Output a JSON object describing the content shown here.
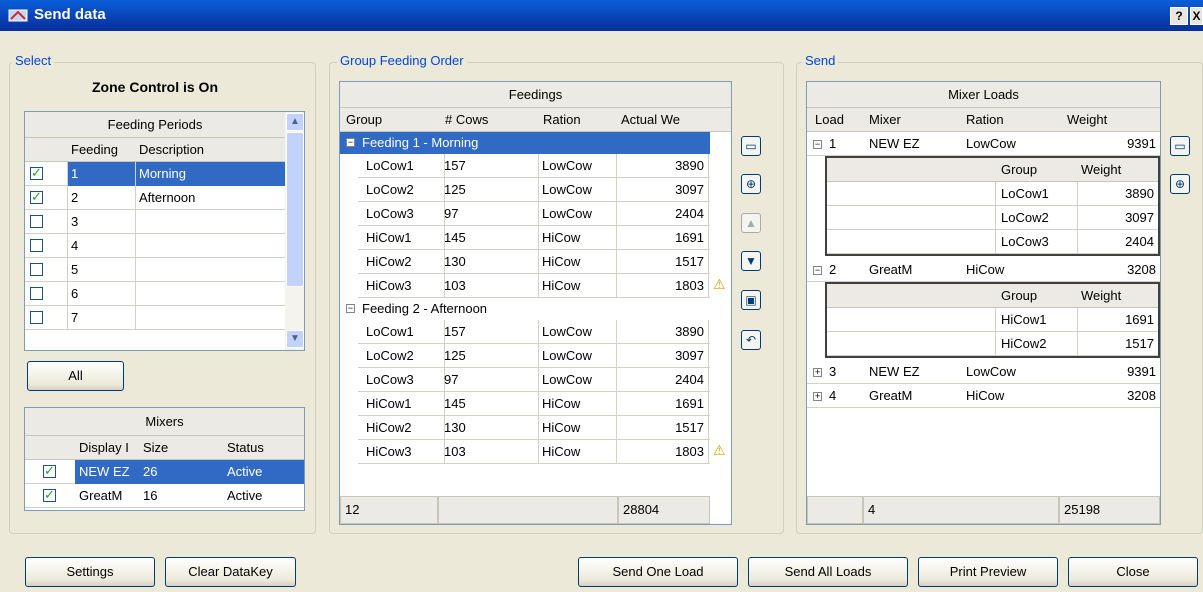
{
  "window": {
    "title": "Send data"
  },
  "select": {
    "legend": "Select",
    "zone_status": "Zone Control is On",
    "feeding_periods": {
      "title": "Feeding Periods",
      "col_feeding": "Feeding",
      "col_description": "Description",
      "rows": [
        {
          "feeding": "1",
          "description": "Morning",
          "checked": true
        },
        {
          "feeding": "2",
          "description": "Afternoon",
          "checked": true
        },
        {
          "feeding": "3",
          "description": "",
          "checked": false
        },
        {
          "feeding": "4",
          "description": "",
          "checked": false
        },
        {
          "feeding": "5",
          "description": "",
          "checked": false
        },
        {
          "feeding": "6",
          "description": "",
          "checked": false
        },
        {
          "feeding": "7",
          "description": "",
          "checked": false
        }
      ]
    },
    "all_label": "All",
    "mixers": {
      "title": "Mixers",
      "col_display": "Display I",
      "col_size": "Size",
      "col_status": "Status",
      "rows": [
        {
          "name": "NEW EZ",
          "size": "26",
          "status": "Active"
        },
        {
          "name": "GreatM",
          "size": "16",
          "status": "Active"
        }
      ]
    }
  },
  "order": {
    "legend": "Group Feeding Order",
    "title": "Feedings",
    "columns": [
      "Group",
      "# Cows",
      "Ration",
      "Actual We"
    ],
    "feedings": [
      {
        "label": "Feeding 1 - Morning",
        "rows": [
          {
            "group": "LoCow1",
            "cows": "157",
            "ration": "LowCow",
            "weight": "3890",
            "warn": false
          },
          {
            "group": "LoCow2",
            "cows": "125",
            "ration": "LowCow",
            "weight": "3097",
            "warn": false
          },
          {
            "group": "LoCow3",
            "cows": "97",
            "ration": "LowCow",
            "weight": "2404",
            "warn": false
          },
          {
            "group": "HiCow1",
            "cows": "145",
            "ration": "HiCow",
            "weight": "1691",
            "warn": false
          },
          {
            "group": "HiCow2",
            "cows": "130",
            "ration": "HiCow",
            "weight": "1517",
            "warn": false
          },
          {
            "group": "HiCow3",
            "cows": "103",
            "ration": "HiCow",
            "weight": "1803",
            "warn": true
          }
        ]
      },
      {
        "label": "Feeding 2 - Afternoon",
        "rows": [
          {
            "group": "LoCow1",
            "cows": "157",
            "ration": "LowCow",
            "weight": "3890",
            "warn": false
          },
          {
            "group": "LoCow2",
            "cows": "125",
            "ration": "LowCow",
            "weight": "3097",
            "warn": false
          },
          {
            "group": "LoCow3",
            "cows": "97",
            "ration": "LowCow",
            "weight": "2404",
            "warn": false
          },
          {
            "group": "HiCow1",
            "cows": "145",
            "ration": "HiCow",
            "weight": "1691",
            "warn": false
          },
          {
            "group": "HiCow2",
            "cows": "130",
            "ration": "HiCow",
            "weight": "1517",
            "warn": false
          },
          {
            "group": "HiCow3",
            "cows": "103",
            "ration": "HiCow",
            "weight": "1803",
            "warn": true
          }
        ]
      }
    ],
    "footer_count": "12",
    "footer_total": "28804"
  },
  "send": {
    "legend": "Send",
    "title": "Mixer Loads",
    "columns": [
      "Load",
      "Mixer",
      "Ration",
      "Weight"
    ],
    "sub_columns": [
      "Group",
      "Weight"
    ],
    "loads": [
      {
        "load": "1",
        "mixer": "NEW EZ",
        "ration": "LowCow",
        "weight": "9391",
        "expanded": true,
        "groups": [
          {
            "group": "LoCow1",
            "weight": "3890"
          },
          {
            "group": "LoCow2",
            "weight": "3097"
          },
          {
            "group": "LoCow3",
            "weight": "2404"
          }
        ]
      },
      {
        "load": "2",
        "mixer": "GreatM",
        "ration": "HiCow",
        "weight": "3208",
        "expanded": true,
        "groups": [
          {
            "group": "HiCow1",
            "weight": "1691"
          },
          {
            "group": "HiCow2",
            "weight": "1517"
          }
        ]
      },
      {
        "load": "3",
        "mixer": "NEW EZ",
        "ration": "LowCow",
        "weight": "9391",
        "expanded": false,
        "groups": []
      },
      {
        "load": "4",
        "mixer": "GreatM",
        "ration": "HiCow",
        "weight": "3208",
        "expanded": false,
        "groups": []
      }
    ],
    "footer_count": "4",
    "footer_total": "25198"
  },
  "buttons": {
    "settings": "Settings",
    "clear_datakey": "Clear DataKey",
    "send_one": "Send One Load",
    "send_all": "Send All Loads",
    "print_preview": "Print Preview",
    "close": "Close"
  },
  "icons": {
    "help": "?",
    "close": "X"
  },
  "colors": {
    "selection": "#316ac5",
    "legend": "#0046d5",
    "title_bar": "#0a4fc8"
  }
}
